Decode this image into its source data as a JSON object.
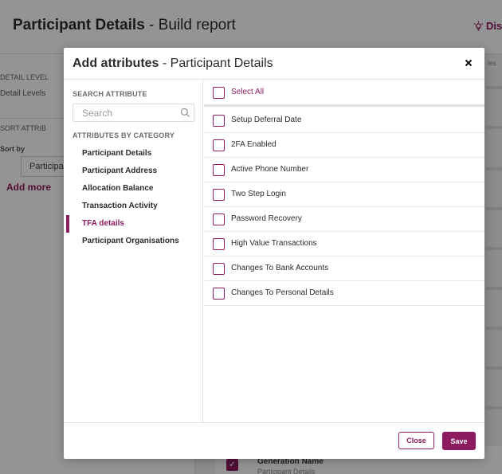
{
  "background": {
    "title_bold": "Participant Details",
    "title_rest": " - Build report",
    "hint_label": "Dis",
    "detail_level_label": "DETAIL LEVEL",
    "detail_levels_value": "Detail Levels",
    "sort_attributes_label": "SORT ATTRIB",
    "sort_by_label": "Sort by",
    "sort_select_value": "Participa",
    "add_more_link": "Add more",
    "right_hint_text": "tes",
    "selected_item_name": "Generation Name",
    "selected_item_category": "Participant Details"
  },
  "modal": {
    "title_bold": "Add attributes",
    "title_rest": " - Participant Details",
    "search": {
      "label": "SEARCH ATTRIBUTE",
      "placeholder": "Search"
    },
    "categories_label": "ATTRIBUTES BY CATEGORY",
    "categories": [
      "Participant Details",
      "Participant Address",
      "Allocation Balance",
      "Transaction Activity",
      "TFA details",
      "Participant Organisations"
    ],
    "active_category": "TFA details",
    "select_all_label": "Select All",
    "attributes": [
      "Setup Deferral Date",
      "2FA Enabled",
      "Active Phone Number",
      "Two Step Login",
      "Password Recovery",
      "High Value Transactions",
      "Changes To Bank Accounts",
      "Changes To Personal Details"
    ],
    "footer": {
      "close_label": "Close",
      "save_label": "Save"
    }
  },
  "colors": {
    "accent": "#8c1b5f",
    "overlay": "rgba(0,0,0,0.42)"
  }
}
